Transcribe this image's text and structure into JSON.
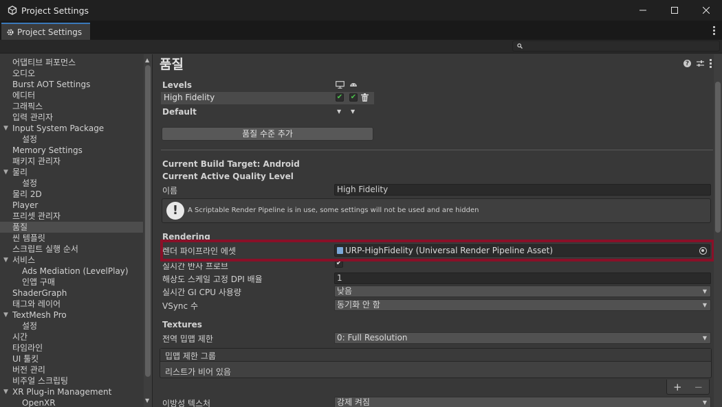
{
  "window": {
    "title": "Project Settings"
  },
  "tab": {
    "label": "Project Settings"
  },
  "search": {
    "placeholder": ""
  },
  "sidebar": {
    "items": [
      {
        "label": "어댑티브 퍼포먼스",
        "indent": 0
      },
      {
        "label": "오디오",
        "indent": 0
      },
      {
        "label": "Burst AOT Settings",
        "indent": 0
      },
      {
        "label": "에디터",
        "indent": 0
      },
      {
        "label": "그래픽스",
        "indent": 0
      },
      {
        "label": "입력 관리자",
        "indent": 0
      },
      {
        "label": "Input System Package",
        "indent": 0,
        "expanded": true
      },
      {
        "label": "설정",
        "indent": 1
      },
      {
        "label": "Memory Settings",
        "indent": 0
      },
      {
        "label": "패키지 관리자",
        "indent": 0
      },
      {
        "label": "물리",
        "indent": 0,
        "expanded": true
      },
      {
        "label": "설정",
        "indent": 1
      },
      {
        "label": "물리 2D",
        "indent": 0
      },
      {
        "label": "Player",
        "indent": 0
      },
      {
        "label": "프리셋 관리자",
        "indent": 0
      },
      {
        "label": "품질",
        "indent": 0,
        "selected": true
      },
      {
        "label": "씬 템플릿",
        "indent": 0
      },
      {
        "label": "스크립트 실행 순서",
        "indent": 0
      },
      {
        "label": "서비스",
        "indent": 0,
        "expanded": true
      },
      {
        "label": "Ads Mediation (LevelPlay)",
        "indent": 1
      },
      {
        "label": "인앱 구매",
        "indent": 1
      },
      {
        "label": "ShaderGraph",
        "indent": 0
      },
      {
        "label": "태그와 레이어",
        "indent": 0
      },
      {
        "label": "TextMesh Pro",
        "indent": 0,
        "expanded": true
      },
      {
        "label": "설정",
        "indent": 1
      },
      {
        "label": "시간",
        "indent": 0
      },
      {
        "label": "타임라인",
        "indent": 0
      },
      {
        "label": "UI 툴킷",
        "indent": 0
      },
      {
        "label": "버전 관리",
        "indent": 0
      },
      {
        "label": "비주얼 스크립팅",
        "indent": 0
      },
      {
        "label": "XR Plug-in Management",
        "indent": 0,
        "expanded": true
      },
      {
        "label": "OpenXR",
        "indent": 1
      }
    ]
  },
  "main": {
    "title": "품질",
    "levels": {
      "header": "Levels",
      "rows": [
        {
          "name": "High Fidelity",
          "standalone": true,
          "android": true
        }
      ],
      "default_label": "Default",
      "add_button": "품질 수준 추가"
    },
    "build_target": "Current Build Target: Android",
    "active_level": "Current Active Quality Level",
    "name_label": "이름",
    "name_value": "High Fidelity",
    "info_message": "A Scriptable Render Pipeline is in use, some settings will not be used and are hidden",
    "rendering": {
      "header": "Rendering",
      "render_pipeline_label": "렌더 파이프라인 에셋",
      "render_pipeline_value": "URP-HighFidelity (Universal Render Pipeline Asset)",
      "realtime_reflection_label": "실시간 반사 프로브",
      "realtime_reflection_checked": true,
      "dpi_label": "해상도 스케일 고정 DPI 배율",
      "dpi_value": "1",
      "gi_cpu_label": "실시간 GI CPU 사용량",
      "gi_cpu_value": "낮음",
      "vsync_label": "VSync 수",
      "vsync_value": "동기화 안 함"
    },
    "textures": {
      "header": "Textures",
      "mip_limit_label": "전역 밉맵 제한",
      "mip_limit_value": "0: Full Resolution",
      "mip_group_header": "밉맵 제한 그룹",
      "empty_list": "리스트가 비어 있음",
      "add_symbol": "+",
      "remove_symbol": "−",
      "aniso_label": "이방성 텍스처",
      "aniso_value": "강제 켜짐"
    }
  },
  "colors": {
    "highlight_border": "#8a1028",
    "tab_accent": "#3a79bb",
    "check_green": "#4cc24c"
  },
  "icons": {
    "app": "unity-cube-icon",
    "settings": "gear-icon",
    "help": "help-icon",
    "presets": "sliders-icon",
    "menu": "kebab-menu-icon",
    "standalone": "monitor-icon",
    "android": "android-icon",
    "delete": "trash-icon",
    "object_picker": "object-picker-icon"
  }
}
